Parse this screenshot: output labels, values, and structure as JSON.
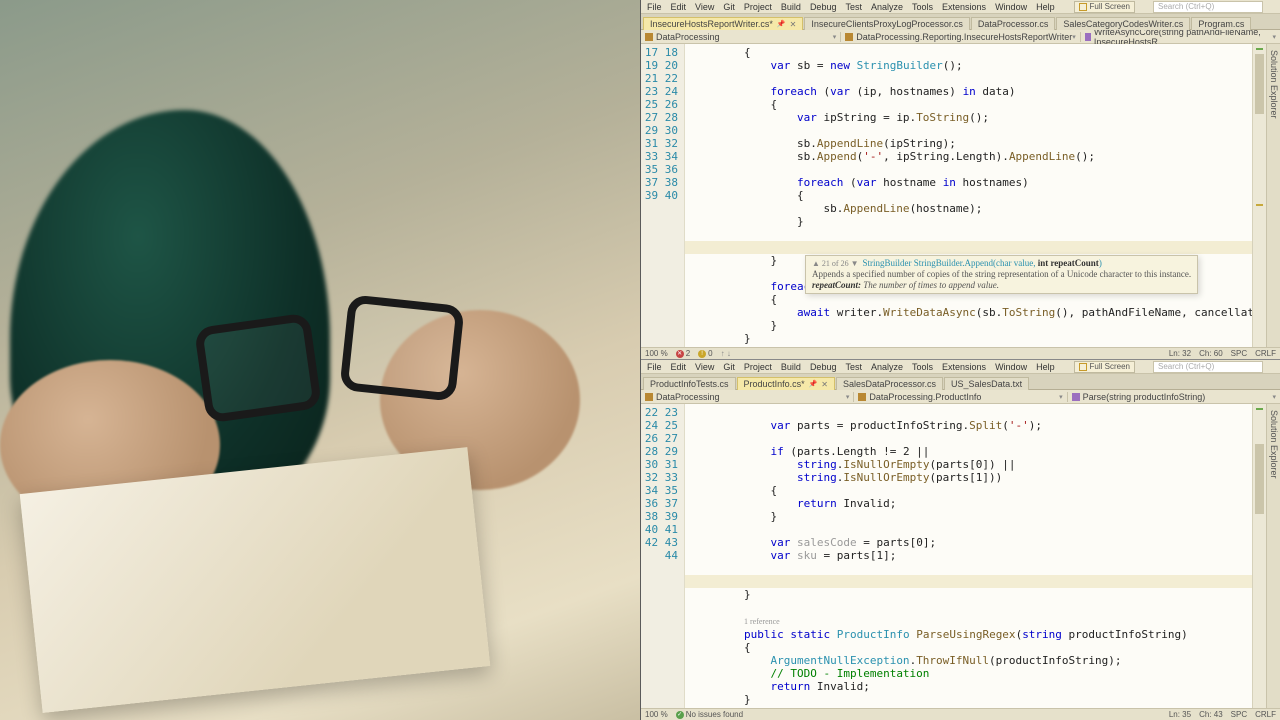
{
  "menus": [
    "File",
    "Edit",
    "View",
    "Git",
    "Project",
    "Build",
    "Debug",
    "Test",
    "Analyze",
    "Tools",
    "Extensions",
    "Window",
    "Help"
  ],
  "fullscreen_label": "Full Screen",
  "search_placeholder": "Search (Ctrl+Q)",
  "top": {
    "tabs": [
      {
        "label": "InsecureHostsReportWriter.cs*",
        "active": true
      },
      {
        "label": "InsecureClientsProxyLogProcessor.cs",
        "active": false
      },
      {
        "label": "DataProcessor.cs",
        "active": false
      },
      {
        "label": "SalesCategoryCodesWriter.cs",
        "active": false
      },
      {
        "label": "Program.cs",
        "active": false
      }
    ],
    "nav": {
      "ns": "DataProcessing",
      "class": "DataProcessing.Reporting.InsecureHostsReportWriter",
      "member": "WriteAsyncCore(string pathAndFileName, InsecureHostsR"
    },
    "first_line": 17,
    "last_line": 40,
    "highlight_line": 32,
    "status": {
      "zoom": "100 %",
      "errors": "2",
      "warnings": "0",
      "ln": "Ln: 32",
      "ch": "Ch: 60",
      "spc": "SPC",
      "eol": "CRLF"
    },
    "tooltip": {
      "counter": "21 of 26",
      "sig": "StringBuilder StringBuilder.Append(char value, int repeatCount)",
      "desc": "Appends a specified number of copies of the string representation of a Unicode character to this instance.",
      "param": "repeatCount:",
      "param_desc": "The number of times to append value."
    },
    "sidetab": "Solution Explorer"
  },
  "bottom": {
    "tabs": [
      {
        "label": "ProductInfoTests.cs",
        "active": false
      },
      {
        "label": "ProductInfo.cs*",
        "active": true
      },
      {
        "label": "SalesDataProcessor.cs",
        "active": false
      },
      {
        "label": "US_SalesData.txt",
        "active": false
      }
    ],
    "nav": {
      "ns": "DataProcessing",
      "class": "DataProcessing.ProductInfo",
      "member": "Parse(string productInfoString)"
    },
    "first_line": 22,
    "last_line": 44,
    "highlight_line": 35,
    "status": {
      "zoom": "100 %",
      "issues": "No issues found",
      "ln": "Ln: 35",
      "ch": "Ch: 43",
      "spc": "SPC",
      "eol": "CRLF"
    },
    "sidetab": "Solution Explorer"
  }
}
